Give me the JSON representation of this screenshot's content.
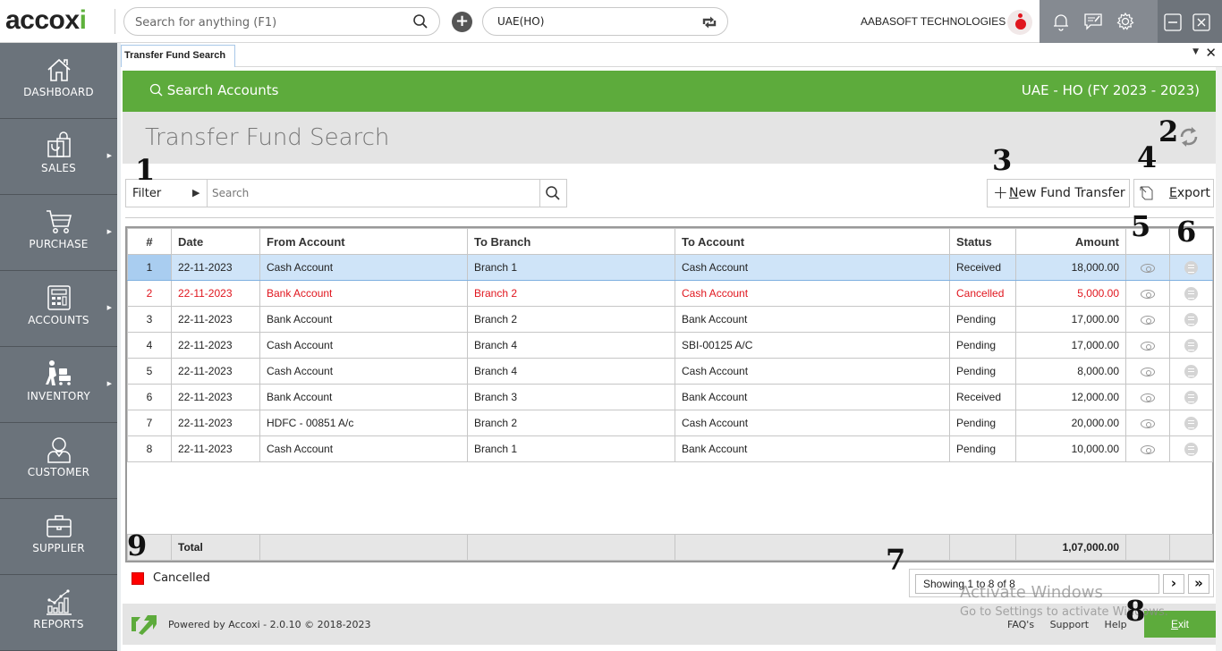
{
  "app": {
    "logo_text": "accoxi",
    "global_search": {
      "placeholder": "Search for anything (F1)"
    },
    "branch_selector": {
      "value": "UAE(HO)"
    },
    "company_name": "AABASOFT TECHNOLOGIES"
  },
  "sidebar": {
    "items": [
      {
        "label": "DASHBOARD",
        "icon": "home-icon",
        "has_submenu": false
      },
      {
        "label": "SALES",
        "icon": "shopping-bag-icon",
        "has_submenu": true
      },
      {
        "label": "PURCHASE",
        "icon": "cart-icon",
        "has_submenu": true
      },
      {
        "label": "ACCOUNTS",
        "icon": "calculator-icon",
        "has_submenu": true
      },
      {
        "label": "INVENTORY",
        "icon": "trolley-icon",
        "has_submenu": true
      },
      {
        "label": "CUSTOMER",
        "icon": "person-icon",
        "has_submenu": false
      },
      {
        "label": "SUPPLIER",
        "icon": "briefcase-icon",
        "has_submenu": false
      },
      {
        "label": "REPORTS",
        "icon": "chart-icon",
        "has_submenu": false
      }
    ]
  },
  "tabs": [
    {
      "label": "Transfer Fund Search",
      "active": true
    }
  ],
  "header": {
    "search_label": "Search Accounts",
    "fiscal_label": "UAE - HO (FY 2023 - 2023)",
    "page_title": "Transfer Fund Search"
  },
  "toolbar": {
    "filter_label": "Filter",
    "search_placeholder": "Search",
    "new_button_prefix": "N",
    "new_button_rest": "ew Fund Transfer",
    "export_prefix": "E",
    "export_rest": "xport"
  },
  "table": {
    "columns": [
      "#",
      "Date",
      "From Account",
      "To Branch",
      "To Account",
      "Status",
      "Amount",
      "",
      ""
    ],
    "rows": [
      {
        "num": "1",
        "date": "22-11-2023",
        "from": "Cash Account",
        "branch": "Branch 1",
        "to": "Cash Account",
        "status": "Received",
        "amount": "18,000.00",
        "selected": true,
        "cancelled": false
      },
      {
        "num": "2",
        "date": "22-11-2023",
        "from": "Bank Account",
        "branch": "Branch 2",
        "to": "Cash Account",
        "status": "Cancelled",
        "amount": "5,000.00",
        "selected": false,
        "cancelled": true
      },
      {
        "num": "3",
        "date": "22-11-2023",
        "from": "Bank Account",
        "branch": "Branch 2",
        "to": "Bank Account",
        "status": "Pending",
        "amount": "17,000.00",
        "selected": false,
        "cancelled": false
      },
      {
        "num": "4",
        "date": "22-11-2023",
        "from": "Cash Account",
        "branch": "Branch 4",
        "to": "SBI-00125 A/C",
        "status": "Pending",
        "amount": "17,000.00",
        "selected": false,
        "cancelled": false
      },
      {
        "num": "5",
        "date": "22-11-2023",
        "from": "Cash Account",
        "branch": "Branch 4",
        "to": "Cash Account",
        "status": "Pending",
        "amount": "8,000.00",
        "selected": false,
        "cancelled": false
      },
      {
        "num": "6",
        "date": "22-11-2023",
        "from": "Bank Account",
        "branch": "Branch 3",
        "to": "Bank Account",
        "status": "Received",
        "amount": "12,000.00",
        "selected": false,
        "cancelled": false
      },
      {
        "num": "7",
        "date": "22-11-2023",
        "from": "HDFC - 00851 A/c",
        "branch": "Branch 2",
        "to": "Cash Account",
        "status": "Pending",
        "amount": "20,000.00",
        "selected": false,
        "cancelled": false
      },
      {
        "num": "8",
        "date": "22-11-2023",
        "from": "Cash Account",
        "branch": "Branch 1",
        "to": "Bank Account",
        "status": "Pending",
        "amount": "10,000.00",
        "selected": false,
        "cancelled": false
      }
    ],
    "total_label": "Total",
    "total_amount": "1,07,000.00"
  },
  "legend": {
    "label": "Cancelled",
    "color": "#ff0000"
  },
  "pagination": {
    "info": "Showing 1 to 8 of 8",
    "next": "›",
    "last": "»"
  },
  "footer": {
    "powered": "Powered by Accoxi - 2.0.10 © 2018-2023",
    "links": [
      "FAQ's",
      "Support",
      "Help"
    ],
    "exit_prefix": "E",
    "exit_rest": "xit"
  },
  "watermark": {
    "line1": "Activate Windows",
    "line2": "Go to Settings to activate Windows."
  },
  "callouts": [
    "1",
    "2",
    "3",
    "4",
    "5",
    "6",
    "7",
    "8",
    "9"
  ],
  "colors": {
    "brand_green": "#5dab3c",
    "sidebar": "#6b737b",
    "cancelled": "#e0161e",
    "selected_row": "#cfe4f8"
  }
}
